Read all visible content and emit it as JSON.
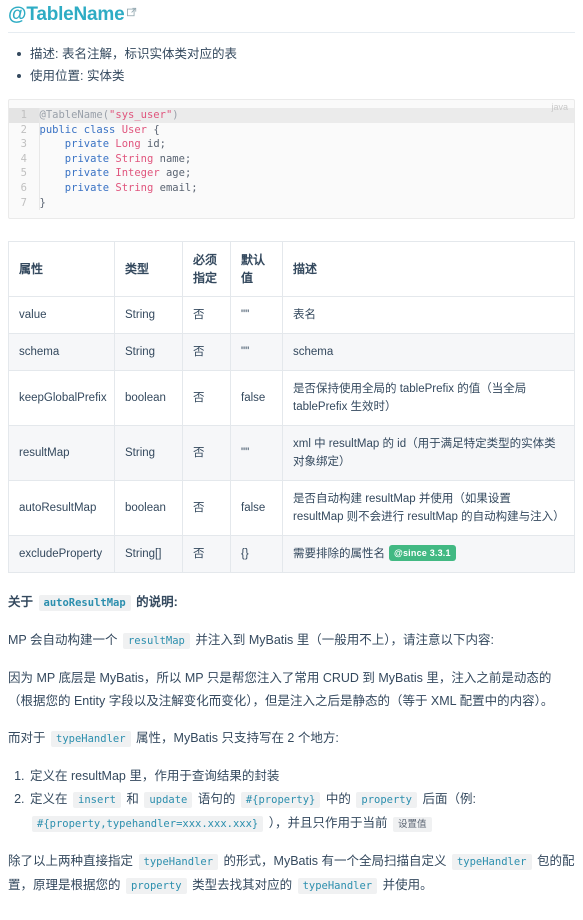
{
  "heading": {
    "title": "@TableName",
    "anchor_icon": "external-link-icon"
  },
  "bullets": [
    "描述: 表名注解，标识实体类对应的表",
    "使用位置: 实体类"
  ],
  "code_block": {
    "language_label": "java",
    "lines": [
      {
        "no": "1",
        "highlighted": true,
        "tokens": [
          {
            "t": "@TableName(",
            "c": "an"
          },
          {
            "t": "\"sys_user\"",
            "c": "s"
          },
          {
            "t": ")",
            "c": "an"
          }
        ]
      },
      {
        "no": "2",
        "highlighted": false,
        "tokens": [
          {
            "t": "public",
            "c": "k"
          },
          {
            "t": " ",
            "c": "p"
          },
          {
            "t": "class",
            "c": "k"
          },
          {
            "t": " ",
            "c": "p"
          },
          {
            "t": "User",
            "c": "t"
          },
          {
            "t": " {",
            "c": "p"
          }
        ]
      },
      {
        "no": "3",
        "highlighted": false,
        "tokens": [
          {
            "t": "    ",
            "c": "p"
          },
          {
            "t": "private",
            "c": "k"
          },
          {
            "t": " ",
            "c": "p"
          },
          {
            "t": "Long",
            "c": "t"
          },
          {
            "t": " id;",
            "c": "p"
          }
        ]
      },
      {
        "no": "4",
        "highlighted": false,
        "tokens": [
          {
            "t": "    ",
            "c": "p"
          },
          {
            "t": "private",
            "c": "k"
          },
          {
            "t": " ",
            "c": "p"
          },
          {
            "t": "String",
            "c": "t"
          },
          {
            "t": " name;",
            "c": "p"
          }
        ]
      },
      {
        "no": "5",
        "highlighted": false,
        "tokens": [
          {
            "t": "    ",
            "c": "p"
          },
          {
            "t": "private",
            "c": "k"
          },
          {
            "t": " ",
            "c": "p"
          },
          {
            "t": "Integer",
            "c": "t"
          },
          {
            "t": " age;",
            "c": "p"
          }
        ]
      },
      {
        "no": "6",
        "highlighted": false,
        "tokens": [
          {
            "t": "    ",
            "c": "p"
          },
          {
            "t": "private",
            "c": "k"
          },
          {
            "t": " ",
            "c": "p"
          },
          {
            "t": "String",
            "c": "t"
          },
          {
            "t": " email;",
            "c": "p"
          }
        ]
      },
      {
        "no": "7",
        "highlighted": false,
        "tokens": [
          {
            "t": "}",
            "c": "p"
          }
        ]
      }
    ]
  },
  "attr_table": {
    "headers": [
      "属性",
      "类型",
      "必须\n指定",
      "默认\n值",
      "描述"
    ],
    "rows": [
      {
        "attr": "value",
        "type": "String",
        "required": "否",
        "default": "\"\"",
        "desc": "表名",
        "badge": ""
      },
      {
        "attr": "schema",
        "type": "String",
        "required": "否",
        "default": "\"\"",
        "desc": "schema",
        "badge": ""
      },
      {
        "attr": "keepGlobalPrefix",
        "type": "boolean",
        "required": "否",
        "default": "false",
        "desc": "是否保持使用全局的 tablePrefix 的值（当全局 tablePrefix 生效时）",
        "badge": ""
      },
      {
        "attr": "resultMap",
        "type": "String",
        "required": "否",
        "default": "\"\"",
        "desc": "xml 中 resultMap 的 id（用于满足特定类型的实体类对象绑定）",
        "badge": ""
      },
      {
        "attr": "autoResultMap",
        "type": "boolean",
        "required": "否",
        "default": "false",
        "desc": "是否自动构建 resultMap 并使用（如果设置 resultMap 则不会进行 resultMap 的自动构建与注入）",
        "badge": ""
      },
      {
        "attr": "excludeProperty",
        "type": "String[]",
        "required": "否",
        "default": "{}",
        "desc": "需要排除的属性名",
        "badge": "@since 3.3.1"
      }
    ]
  },
  "notes": {
    "about_label_pre": "关于",
    "about_code": "autoResultMap",
    "about_label_post": "的说明:",
    "p1_a": "MP 会自动构建一个",
    "p1_code": "resultMap",
    "p1_b": "并注入到 MyBatis 里（一般用不上），请注意以下内容:",
    "p2": "因为 MP 底层是 MyBatis，所以 MP 只是帮您注入了常用 CRUD 到 MyBatis 里，注入之前是动态的（根据您的 Entity 字段以及注解变化而变化），但是注入之后是静态的（等于 XML 配置中的内容）。",
    "p3_a": "而对于",
    "p3_code": "typeHandler",
    "p3_b": "属性，MyBatis 只支持写在 2 个地方:",
    "li1": "定义在 resultMap 里，作用于查询结果的封装",
    "li2_a": "定义在",
    "li2_code1": "insert",
    "li2_b": "和",
    "li2_code2": "update",
    "li2_c": "语句的",
    "li2_code3": "#{property}",
    "li2_d": "中的",
    "li2_code4": "property",
    "li2_e": "后面（例:",
    "li2_code5": "#{property,typehandler=xxx.xxx.xxx}",
    "li2_f": "），并且只作用于当前",
    "li2_code6": "设置值",
    "p4_a": "除了以上两种直接指定",
    "p4_code1": "typeHandler",
    "p4_b": "的形式，MyBatis 有一个全局扫描自定义",
    "p4_code2": "typeHandler",
    "p4_c": "包的配置，原理是根据您的",
    "p4_code3": "property",
    "p4_d": "类型去找其对应的",
    "p4_code4": "typeHandler",
    "p4_e": "并使用。"
  },
  "colors": {
    "title": "#2eacc4",
    "text": "#34495e",
    "inline_code": "#2c8fae",
    "badge_bg": "#42b983",
    "code_keyword": "#3972c4",
    "code_type": "#e0557d"
  }
}
